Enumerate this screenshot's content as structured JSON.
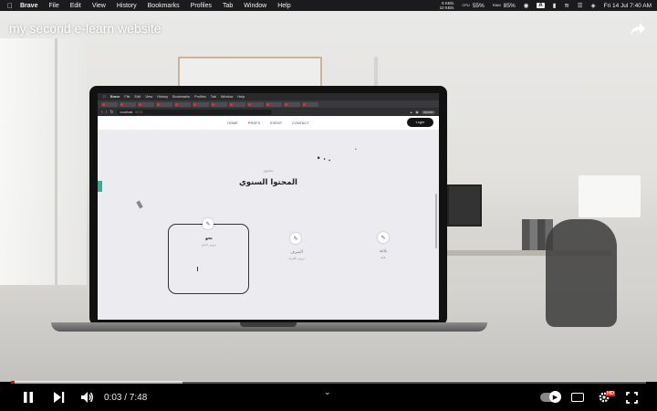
{
  "menubar": {
    "app": "Brave",
    "items": [
      "File",
      "Edit",
      "View",
      "History",
      "Bookmarks",
      "Profiles",
      "Tab",
      "Window",
      "Help"
    ],
    "net_up": "6 KB/s",
    "net_down": "10 KB/s",
    "cpu_label": "CPU",
    "cpu_value": "55%",
    "ram_label": "RAM",
    "ram_value": "85%",
    "input_source": "A",
    "datetime": "Fri 14 Jul  7:40 AM"
  },
  "video": {
    "title": "my second e-learn website",
    "current_time": "0:03",
    "duration": "7:48",
    "time_display": "0:03 / 7:48",
    "played_fraction": 0.006,
    "buffered_fraction": 0.27,
    "quality_badge": "HD"
  },
  "inner_browser": {
    "app": "Brave",
    "menu": [
      "File",
      "Edit",
      "View",
      "History",
      "Bookmarks",
      "Profiles",
      "Tab",
      "Window",
      "Help"
    ],
    "url_host": "localhost",
    "url_port": ":5173",
    "update_button": "Update"
  },
  "site": {
    "nav": [
      "HOME",
      "PROFS",
      "EVENT",
      "CONTACT"
    ],
    "login": "Login",
    "section_sub": "محتوى",
    "section_title": "المحتوا السنوي",
    "cards": [
      {
        "title": "نحو",
        "subtitle": "دروس النحو"
      },
      {
        "title": "الصرف",
        "subtitle": "دروس الصرف"
      },
      {
        "title": "بلاغة",
        "subtitle": "بلاغة"
      }
    ]
  }
}
